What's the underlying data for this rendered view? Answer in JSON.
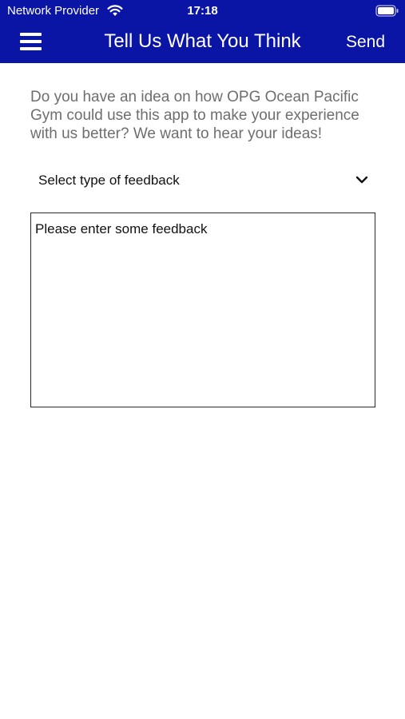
{
  "status_bar": {
    "carrier": "Network Provider",
    "time": "17:18"
  },
  "nav": {
    "title": "Tell Us What You Think",
    "send_label": "Send"
  },
  "intro": {
    "text": "Do you have an idea on how OPG Ocean Pacific Gym could use this app to make your experience with us better? We want to hear your ideas!"
  },
  "feedback_type": {
    "selected_label": "Select type of feedback"
  },
  "feedback_input": {
    "placeholder": "Please enter some feedback"
  },
  "colors": {
    "header_background": "#0a15a6",
    "text_primary": "#111111",
    "text_secondary": "#6e6e6e"
  },
  "icons": [
    "menu-icon",
    "wifi-icon",
    "battery-icon",
    "chevron-down-icon"
  ]
}
